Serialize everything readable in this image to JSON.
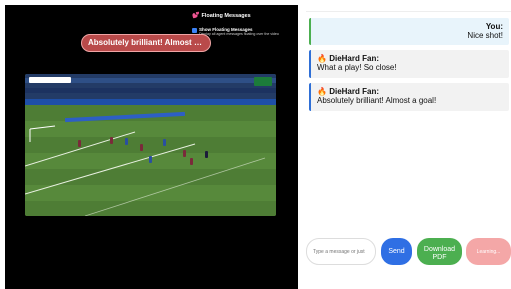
{
  "video": {
    "floating_bubble_text": "Absolutely brilliant! Almost a goal!",
    "settings": {
      "title_emoji": "💕",
      "title": "Floating Messages",
      "toggle_label": "Show Floating Messages",
      "toggle_description": "Display all agent messages floating over the video",
      "toggle_checked": true
    }
  },
  "chat": {
    "messages": [
      {
        "author": "You:",
        "text": "Nice shot!",
        "type": "user"
      },
      {
        "author_icon": "🔥",
        "author": "DieHard Fan:",
        "text": "What a play! So close!",
        "type": "agent"
      },
      {
        "author_icon": "🔥",
        "author": "DieHard Fan:",
        "text": "Absolutely brilliant! Almost a goal!",
        "type": "agent"
      }
    ],
    "input": {
      "placeholder": "Type a message or just",
      "value": ""
    },
    "buttons": {
      "send": "Send",
      "download_pdf": "Download PDF",
      "learning": "Learning..."
    }
  },
  "colors": {
    "send": "#2f6fe4",
    "download": "#4caf50",
    "learning": "#f4a7a7",
    "user_border": "#4caf50",
    "agent_border": "#2f6fd6",
    "bubble": "#b94a4a"
  }
}
